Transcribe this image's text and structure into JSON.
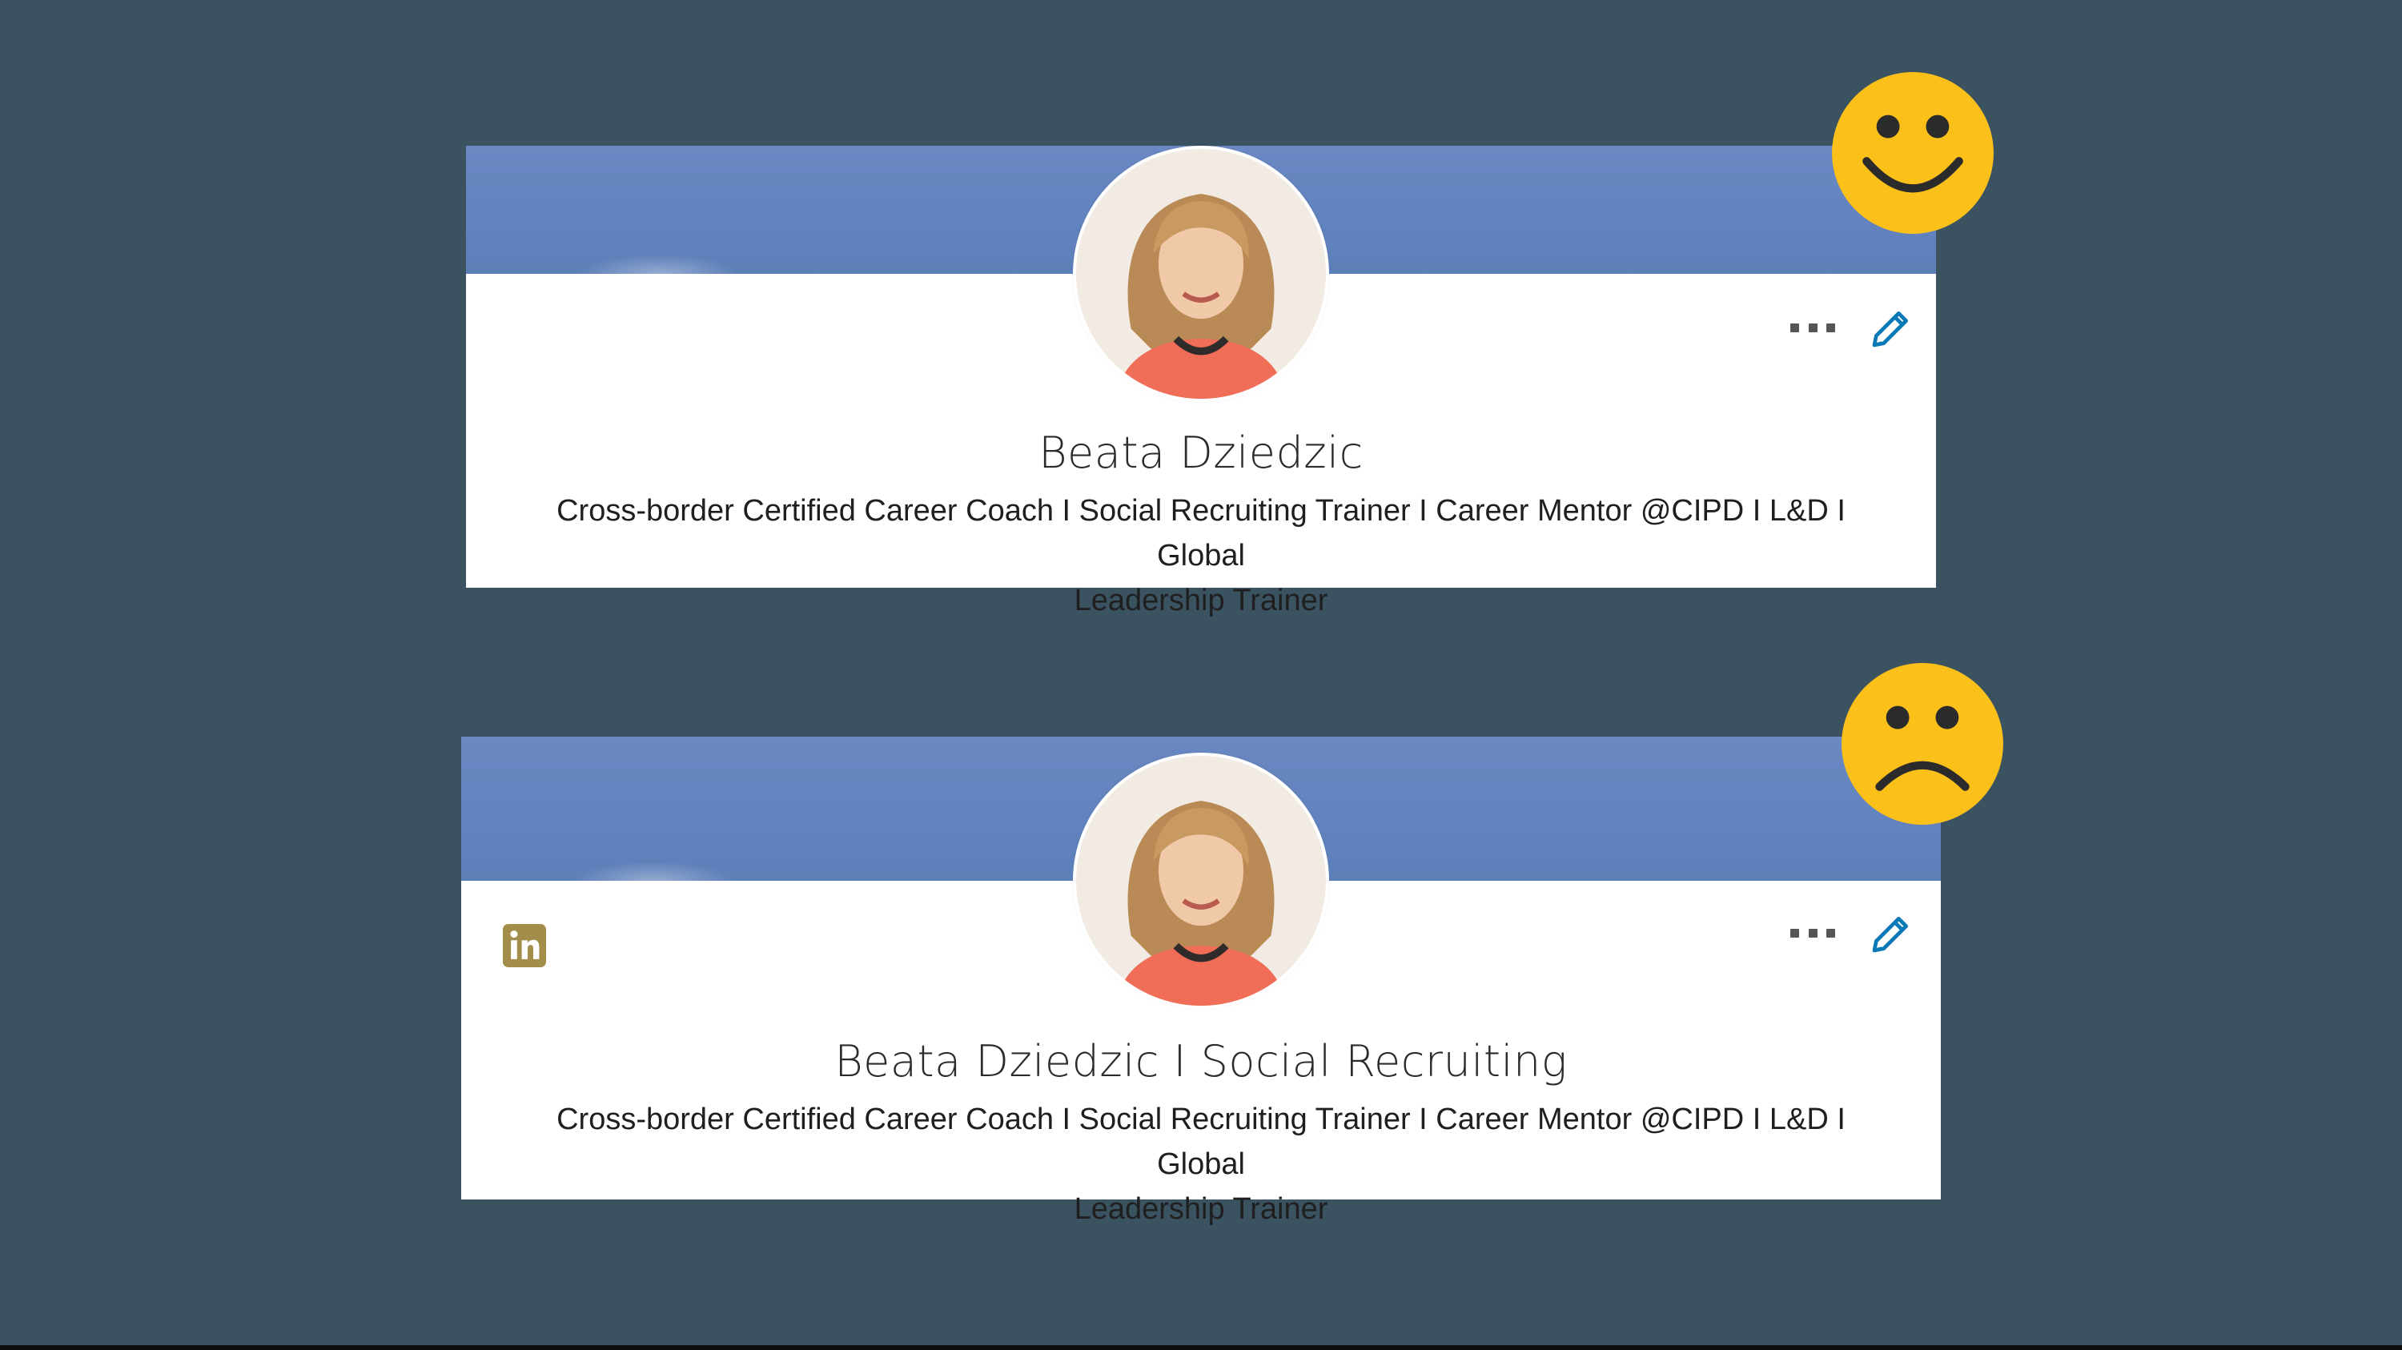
{
  "cards": [
    {
      "name": "Beata Dziedzic",
      "headline_line1": "Cross-border Certified Career Coach I Social Recruiting Trainer I Career Mentor @CIPD I L&D I Global",
      "headline_line2": "Leadership Trainer",
      "more_icon": "more-horizontal-icon",
      "edit_icon": "pencil-icon",
      "emoji": "smiley-face-icon"
    },
    {
      "name": "Beata Dziedzic I Social Recruiting",
      "headline_line1": "Cross-border Certified Career Coach I Social Recruiting Trainer I Career Mentor @CIPD I L&D I Global",
      "headline_line2": "Leadership Trainer",
      "brand_icon": "linkedin-icon",
      "more_icon": "more-horizontal-icon",
      "edit_icon": "pencil-icon",
      "emoji": "frowning-face-icon"
    }
  ],
  "colors": {
    "background": "#3b5361",
    "banner": "#6283be",
    "emoji": "#fcc01a",
    "edit_icon": "#0a79b6",
    "linkedin_icon": "#a38d4a"
  }
}
